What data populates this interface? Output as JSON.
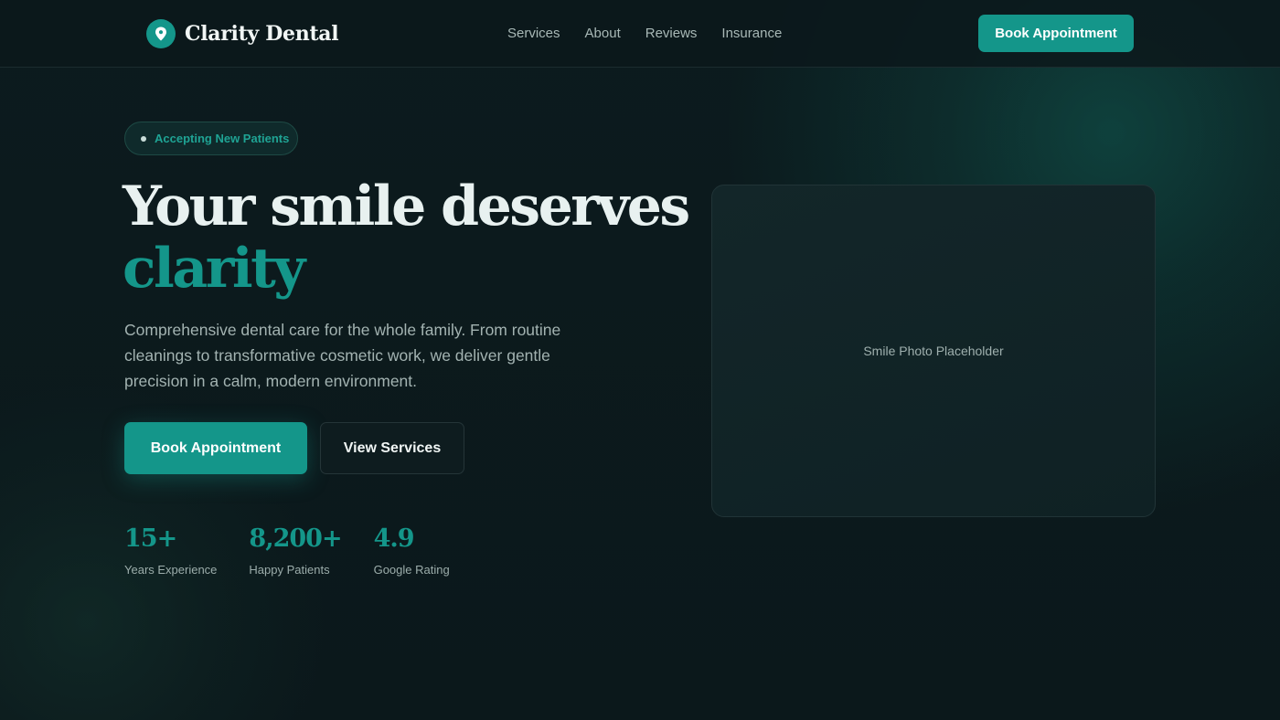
{
  "header": {
    "brand_name": "Clarity Dental",
    "nav": [
      "Services",
      "About",
      "Reviews",
      "Insurance"
    ],
    "cta_label": "Book Appointment"
  },
  "hero": {
    "badge": "Accepting New Patients",
    "headline_line1": "Your smile deserves",
    "headline_accent": "clarity",
    "lead": "Comprehensive dental care for the whole family. From routine cleanings to transformative cosmetic work, we deliver gentle precision in a calm, modern environment.",
    "primary_cta": "Book Appointment",
    "secondary_cta": "View Services",
    "stats": [
      {
        "value": "15+",
        "label": "Years Experience"
      },
      {
        "value": "8,200+",
        "label": "Happy Patients"
      },
      {
        "value": "4.9",
        "label": "Google Rating"
      }
    ],
    "photo_placeholder": "Smile Photo Placeholder"
  },
  "colors": {
    "accent": "#14968a",
    "background": "#0b191c",
    "text": "#e8f0ef",
    "muted": "#a3b3b1"
  },
  "icons": {
    "brand": "location-pin-icon"
  }
}
